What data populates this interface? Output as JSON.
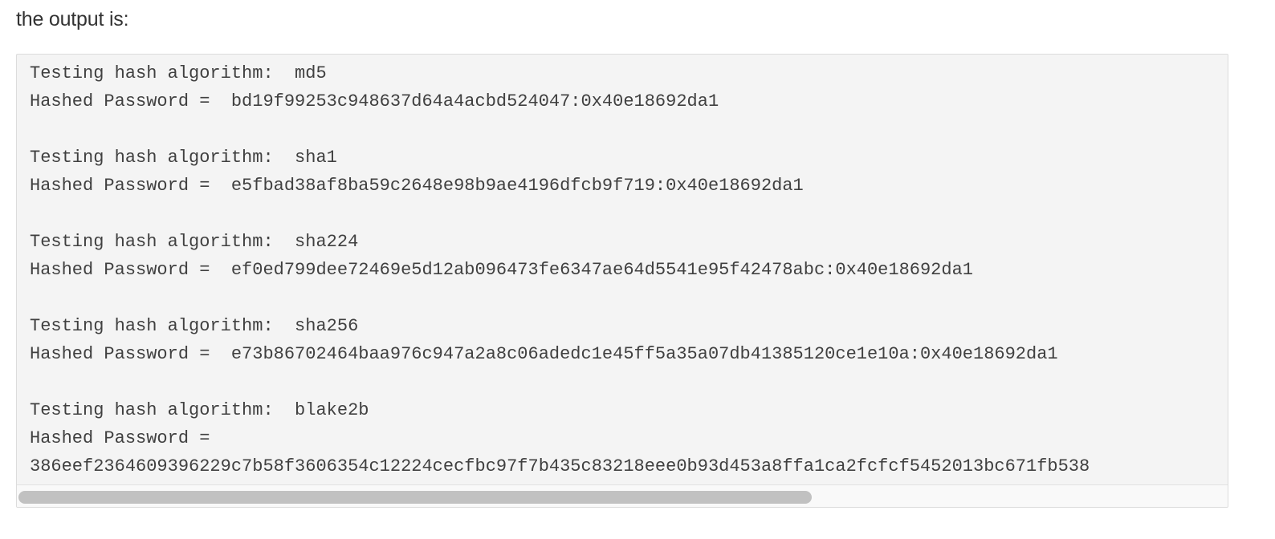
{
  "intro_text": "the output is:",
  "code_output": {
    "lines": [
      "Testing hash algorithm:  md5",
      "Hashed Password =  bd19f99253c948637d64a4acbd524047:0x40e18692da1",
      "",
      "Testing hash algorithm:  sha1",
      "Hashed Password =  e5fbad38af8ba59c2648e98b9ae4196dfcb9f719:0x40e18692da1",
      "",
      "Testing hash algorithm:  sha224",
      "Hashed Password =  ef0ed799dee72469e5d12ab096473fe6347ae64d5541e95f42478abc:0x40e18692da1",
      "",
      "Testing hash algorithm:  sha256",
      "Hashed Password =  e73b86702464baa976c947a2a8c06adedc1e45ff5a35a07db41385120ce1e10a:0x40e18692da1",
      "",
      "Testing hash algorithm:  blake2b",
      "Hashed Password =",
      "386eef2364609396229c7b58f3606354c12224cecfbc97f7b435c83218eee0b93d453a8ffa1ca2fcfcf5452013bc671fb538"
    ]
  },
  "scrollbar": {
    "horizontal_visible_fraction": 0.66,
    "scroll_position_fraction": 0.0
  }
}
